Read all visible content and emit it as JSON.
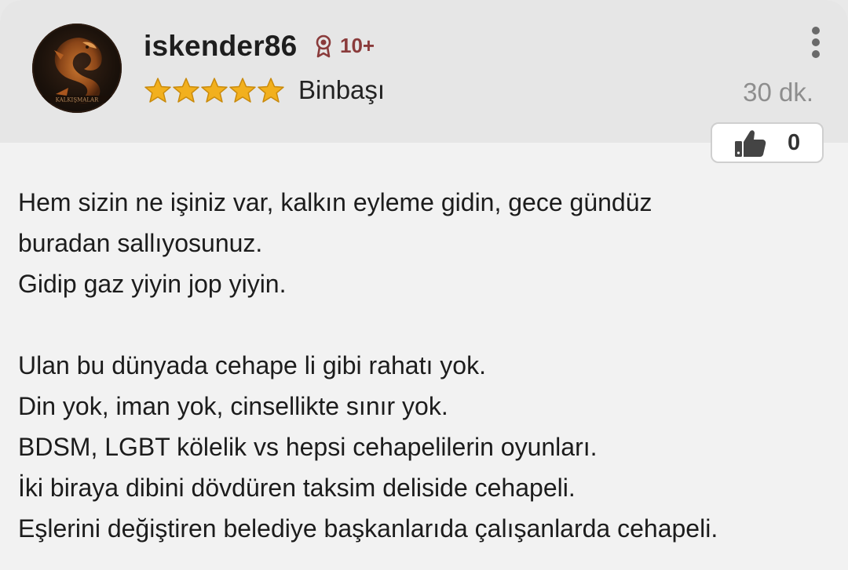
{
  "comment": {
    "username": "iskender86",
    "badge_count": "10+",
    "rank": "Binbaşı",
    "stars": 5,
    "time": "30 dk.",
    "likes": "0",
    "lines": [
      "Hem sizin ne işiniz var, kalkın eyleme gidin, gece gündüz",
      "buradan sallıyosunuz.",
      "Gidip gaz yiyin jop yiyin.",
      "",
      "Ulan bu dünyada cehape li gibi rahatı yok.",
      "Din yok, iman yok, cinsellikte sınır yok.",
      "BDSM, LGBT kölelik vs hepsi cehapelilerin oyunları.",
      "İki biraya dibini dövdüren taksim deliside cehapeli.",
      "Eşlerini değiştiren belediye başkanlarıda çalışanlarda cehapeli."
    ]
  },
  "icons": {
    "avatar": "dragon-avatar-icon",
    "badge": "award-ribbon-icon",
    "star": "star-icon",
    "menu": "more-vertical-icon",
    "like": "thumbs-up-icon"
  },
  "colors": {
    "header_bg": "#e6e6e6",
    "card_bg": "#f2f2f2",
    "star_fill": "#f2b01e",
    "badge_red": "#8a3b3b",
    "time_gray": "#8e8e8e"
  }
}
